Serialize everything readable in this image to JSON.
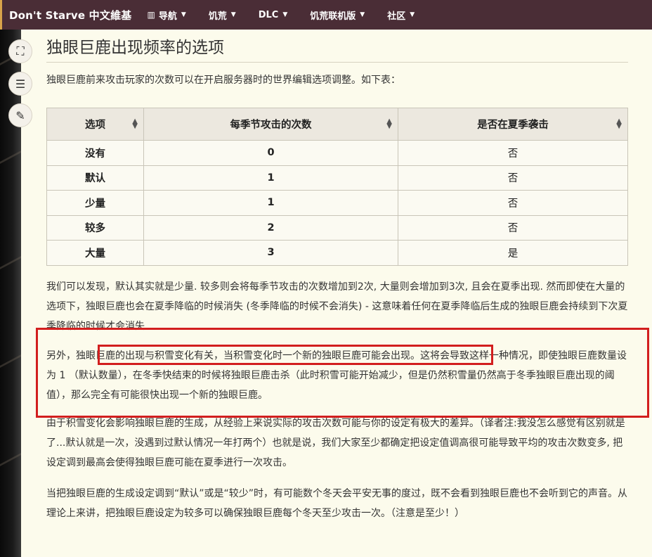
{
  "nav": {
    "site_title": "Don't Starve 中文維基",
    "items": [
      {
        "label": "导航",
        "icon": "map-icon"
      },
      {
        "label": "饥荒"
      },
      {
        "label": "DLC"
      },
      {
        "label": "饥荒联机版"
      },
      {
        "label": "社区"
      }
    ]
  },
  "tools": {
    "fullscreen": "⛶",
    "toc": "☰",
    "edit": "✎"
  },
  "page": {
    "title": "独眼巨鹿出现频率的选项",
    "intro": "独眼巨鹿前来攻击玩家的次数可以在开启服务器时的世界编辑选项调整。如下表："
  },
  "table": {
    "headers": [
      "选项",
      "每季节攻击的次数",
      "是否在夏季袭击"
    ],
    "rows": [
      {
        "option": "没有",
        "count": "0",
        "summer": "否"
      },
      {
        "option": "默认",
        "count": "1",
        "summer": "否"
      },
      {
        "option": "少量",
        "count": "1",
        "summer": "否"
      },
      {
        "option": "较多",
        "count": "2",
        "summer": "否"
      },
      {
        "option": "大量",
        "count": "3",
        "summer": "是"
      }
    ]
  },
  "paragraphs": {
    "p1": "我们可以发现，默认其实就是少量. 较多则会将每季节攻击的次数增加到2次, 大量则会增加到3次, 且会在夏季出现. 然而即使在大量的选项下，独眼巨鹿也会在夏季降临的时候消失 (冬季降临的时候不会消失) - 这意味着任何在夏季降临后生成的独眼巨鹿会持续到下次夏季降临的时候才会消失",
    "p2": "另外，独眼巨鹿的出现与积雪变化有关，当积雪变化时一个新的独眼巨鹿可能会出现。这将会导致这样一种情况，即使独眼巨鹿数量设为 1 （默认数量），在冬季快结束的时候将独眼巨鹿击杀（此时积雪可能开始减少，但是仍然积雪量仍然高于冬季独眼巨鹿出现的阈值），那么完全有可能很快出现一个新的独眼巨鹿。",
    "p3": "由于积雪变化会影响独眼巨鹿的生成，从经验上来说实际的攻击次数可能与你的设定有极大的差异。（译者注:我没怎么感觉有区别就是了...默认就是一次，没遇到过默认情况一年打两个）也就是说，我们大家至少都确定把设定值调高很可能导致平均的攻击次数变多, 把设定调到最高会使得独眼巨鹿可能在夏季进行一次攻击。",
    "p4": "当把独眼巨鹿的生成设定调到“默认”或是“较少”时，有可能数个冬天会平安无事的度过，既不会看到独眼巨鹿也不会听到它的声音。从理论上来讲，把独眼巨鹿设定为较多可以确保独眼巨鹿每个冬天至少攻击一次。（注意是至少！）"
  },
  "colors": {
    "nav_bg": "#4a2d36",
    "content_bg": "#fcfbec",
    "highlight_box": "#d21e1e"
  }
}
